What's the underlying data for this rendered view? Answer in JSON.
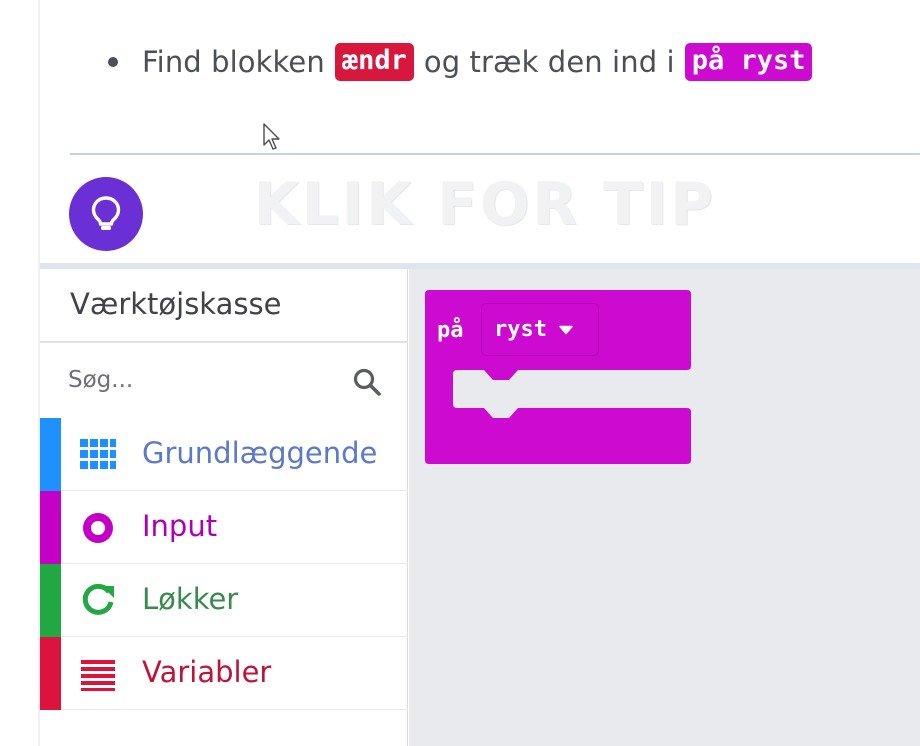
{
  "instruction": {
    "prefix": "Find blokken",
    "chip1": "ændr",
    "middle": "og træk den ind i",
    "chip2": "på ryst"
  },
  "hint": {
    "text": "KLIK FOR TIP",
    "icon": "lightbulb-icon",
    "button_color": "#6b2fd6"
  },
  "toolbox": {
    "title": "Værktøjskasse",
    "search_placeholder": "Søg...",
    "categories": [
      {
        "label": "Grundlæggende",
        "icon": "grid-icon",
        "color": "#1e90ff",
        "text_color": "#5c79c9"
      },
      {
        "label": "Input",
        "icon": "target-circle-icon",
        "color": "#c400c7",
        "text_color": "#b000b5"
      },
      {
        "label": "Løkker",
        "icon": "refresh-icon",
        "color": "#21a842",
        "text_color": "#3a8a4f"
      },
      {
        "label": "Variabler",
        "icon": "list-lines-icon",
        "color": "#dc143c",
        "text_color": "#c01338"
      }
    ]
  },
  "workspace": {
    "block": {
      "label": "på",
      "dropdown_value": "ryst",
      "color": "#cd0ad0"
    }
  }
}
